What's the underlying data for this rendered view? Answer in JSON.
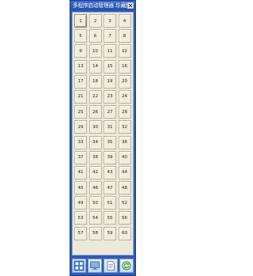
{
  "window": {
    "title": "多程序启动管理器  珍藏版"
  },
  "icons": {
    "close": "close-icon",
    "tool1": "apps-icon",
    "tool2": "monitor-icon",
    "tool3": "document-icon",
    "tool4": "refresh-icon"
  },
  "colors": {
    "window_frame": "#2f5bb3",
    "title_bar": "#244fa6",
    "panel_bg": "#ece9d8",
    "slot_bg": "#f1ecdc"
  },
  "slots": {
    "s1": "1",
    "s2": "2",
    "s3": "3",
    "s4": "4",
    "s5": "5",
    "s6": "6",
    "s7": "7",
    "s8": "8",
    "s9": "9",
    "s10": "10",
    "s11": "11",
    "s12": "12",
    "s13": "13",
    "s14": "14",
    "s15": "15",
    "s16": "16",
    "s17": "17",
    "s18": "18",
    "s19": "19",
    "s20": "20",
    "s21": "21",
    "s22": "22",
    "s23": "23",
    "s24": "24",
    "s25": "25",
    "s26": "26",
    "s27": "27",
    "s28": "28",
    "s29": "29",
    "s30": "30",
    "s31": "31",
    "s32": "32",
    "s33": "33",
    "s34": "34",
    "s35": "35",
    "s36": "36",
    "s37": "37",
    "s38": "38",
    "s39": "39",
    "s40": "40",
    "s41": "41",
    "s42": "42",
    "s43": "43",
    "s44": "44",
    "s45": "45",
    "s46": "46",
    "s47": "47",
    "s48": "48",
    "s49": "49",
    "s50": "50",
    "s51": "51",
    "s52": "52",
    "s53": "53",
    "s54": "54",
    "s55": "55",
    "s56": "56",
    "s57": "57",
    "s58": "58",
    "s59": "59",
    "s60": "60"
  }
}
